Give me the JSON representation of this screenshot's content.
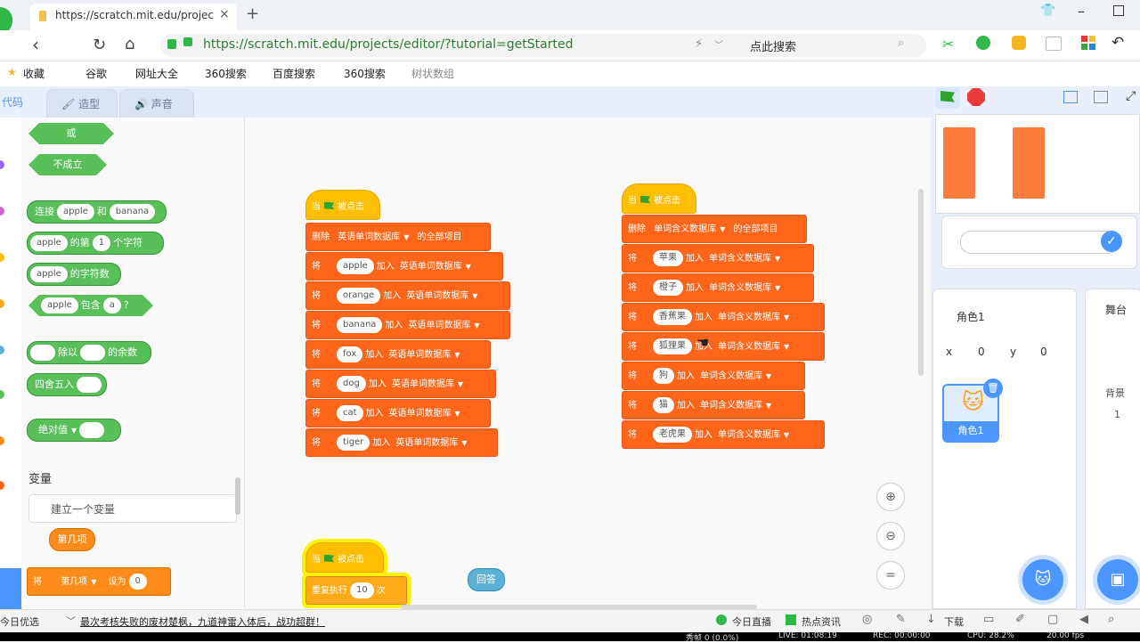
{
  "browser": {
    "tab_title": "https://scratch.mit.edu/projec",
    "url": "https://scratch.mit.edu/projects/editor/?tutorial=getStarted",
    "search_hint": "点此搜索",
    "bookmarks": [
      "收藏",
      "谷歌",
      "网址大全",
      "360搜索",
      "百度搜索",
      "360搜索",
      "树状数组"
    ]
  },
  "scratch": {
    "tabs": {
      "code": "代码",
      "costume": "造型",
      "sound": "声音"
    },
    "palette": {
      "or_label": "或",
      "not_label": "不成立",
      "join": {
        "label": "连接",
        "a": "apple",
        "mid": "和",
        "b": "banana"
      },
      "letter_of": {
        "a": "apple",
        "mid": "的第",
        "n": "1",
        "suffix": "个字符"
      },
      "length_of": {
        "a": "apple",
        "suffix": "的字符数"
      },
      "contains": {
        "a": "apple",
        "mid": "包含",
        "b": "a",
        "suffix": "?"
      },
      "mod": {
        "mid": "除以",
        "suffix": "的余数"
      },
      "round": "四舍五入",
      "abs": "绝对值",
      "variables_title": "变量",
      "make_variable": "建立一个变量",
      "var_name": "第几项",
      "set_block": {
        "prefix": "将",
        "var": "第几项",
        "mid": "设为",
        "value": "0"
      }
    },
    "script1": {
      "hat": {
        "when": "当",
        "clicked": "被点击"
      },
      "delete_block": {
        "prefix": "删除",
        "list": "英语单词数据库",
        "suffix": "的全部项目"
      },
      "add_items": [
        "apple",
        "orange",
        "banana",
        "fox",
        "dog",
        "cat",
        "tiger"
      ],
      "add_prefix": "将",
      "add_mid": "加入",
      "add_list": "英语单词数据库"
    },
    "script2": {
      "hat": {
        "when": "当",
        "clicked": "被点击"
      },
      "delete_block": {
        "prefix": "删除",
        "list": "单词含义数据库",
        "suffix": "的全部项目"
      },
      "add_items": [
        "苹果",
        "橙子",
        "香蕉果",
        "狐狸果",
        "狗",
        "猫",
        "老虎果"
      ],
      "add_prefix": "将",
      "add_mid": "加入",
      "add_list": "单词含义数据库"
    },
    "script3": {
      "hat": {
        "when": "当",
        "clicked": "被点击"
      },
      "repeat": {
        "label": "重复执行",
        "count": "10",
        "suffix": "次"
      }
    },
    "answer_reporter": "回答",
    "sprite": {
      "name": "角色1",
      "x_label": "x",
      "x": "0",
      "y_label": "y",
      "y": "0"
    },
    "stage": {
      "title": "舞台",
      "backdrops_label": "背景",
      "backdrops": "1"
    }
  },
  "taskbar": {
    "left": "今日优选",
    "news": "最次考核失败的废材楚枫，九道神雷入体后，战功超群！",
    "live": "今日直播",
    "hot": "热点资讯",
    "download": "下载",
    "bottom_status": [
      "秀帧 0 (0.0%)",
      "LIVE: 01:08:19",
      "REC: 00:00:00",
      "CPU: 28.2%",
      "20.00 fps"
    ]
  },
  "colors": {
    "control": "#ffbf00",
    "list": "#ff661a",
    "operator": "#59c059",
    "accent": "#4c97ff"
  }
}
